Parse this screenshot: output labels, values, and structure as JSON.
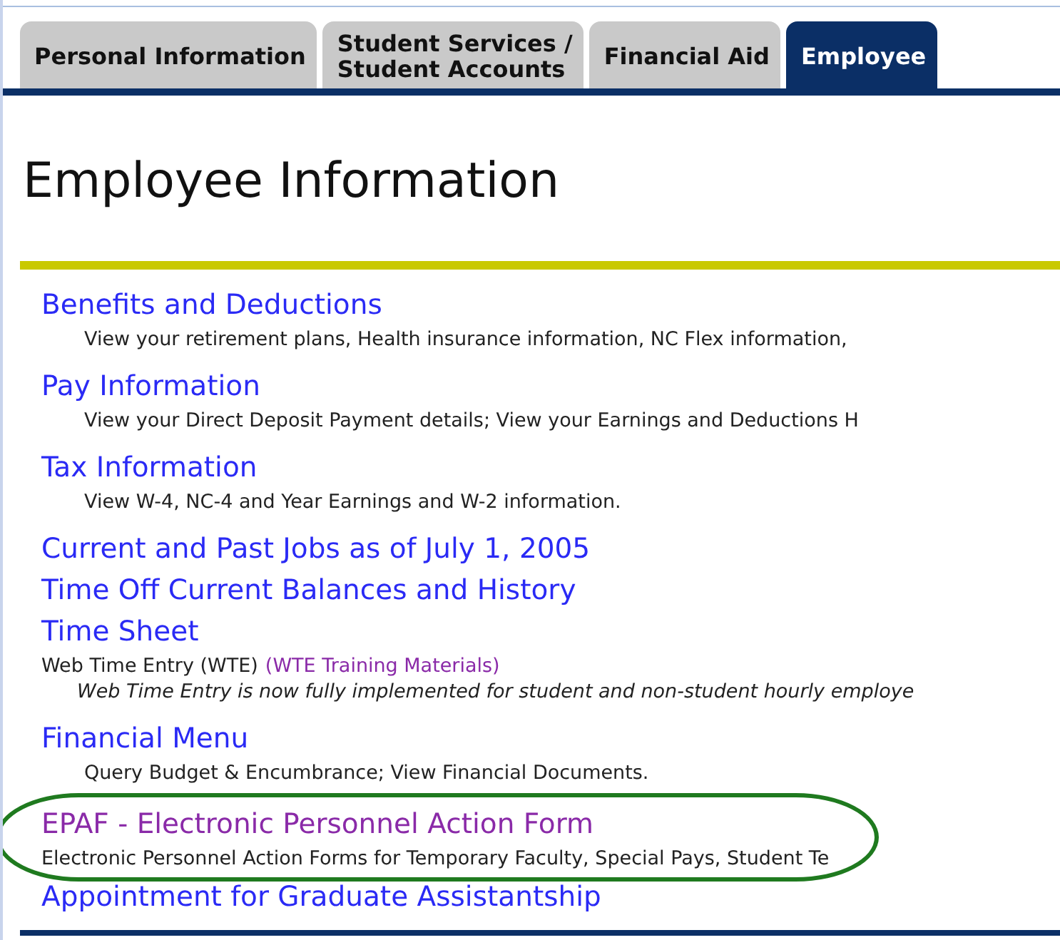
{
  "tabs": [
    {
      "label": "Personal Information",
      "selected": false
    },
    {
      "label": "Student Services /\nStudent Accounts",
      "selected": false
    },
    {
      "label": "Financial Aid",
      "selected": false
    },
    {
      "label": "Employee",
      "selected": true
    }
  ],
  "heading": "Employee Information",
  "items": [
    {
      "title": "Benefits and Deductions",
      "visited": false,
      "lines": [
        {
          "kind": "indented",
          "text": "View your retirement plans, Health insurance information, NC Flex information,"
        }
      ]
    },
    {
      "title": "Pay Information",
      "visited": false,
      "lines": [
        {
          "kind": "indented",
          "text": "View your Direct Deposit Payment details; View your Earnings and Deductions H"
        }
      ]
    },
    {
      "title": "Tax Information",
      "visited": false,
      "lines": [
        {
          "kind": "indented",
          "text": "View W-4, NC-4 and Year Earnings and W-2 information."
        }
      ]
    },
    {
      "title": "Current and Past Jobs as of July 1, 2005",
      "visited": false
    },
    {
      "title": "Time Off Current Balances and History",
      "visited": false
    },
    {
      "title": "Time Sheet",
      "visited": false,
      "lines": [
        {
          "kind": "plain",
          "text": "Web Time Entry (WTE)",
          "link": {
            "text": "(WTE Training Materials)",
            "visited": true
          }
        },
        {
          "kind": "italic",
          "text": "Web Time Entry is now fully implemented for student and non-student hourly employe"
        }
      ]
    },
    {
      "title": "Financial Menu",
      "visited": false,
      "lines": [
        {
          "kind": "indented",
          "text": "Query Budget & Encumbrance; View Financial Documents."
        }
      ]
    },
    {
      "title": "EPAF - Electronic Personnel Action Form",
      "visited": true,
      "highlight": {
        "kind": "ellipse",
        "color": "#1f7a1f"
      },
      "lines": [
        {
          "kind": "plain",
          "text": "Electronic Personnel Action Forms for Temporary Faculty, Special Pays, Student Te"
        }
      ]
    },
    {
      "title": "Appointment for Graduate Assistantship",
      "visited": false
    }
  ]
}
